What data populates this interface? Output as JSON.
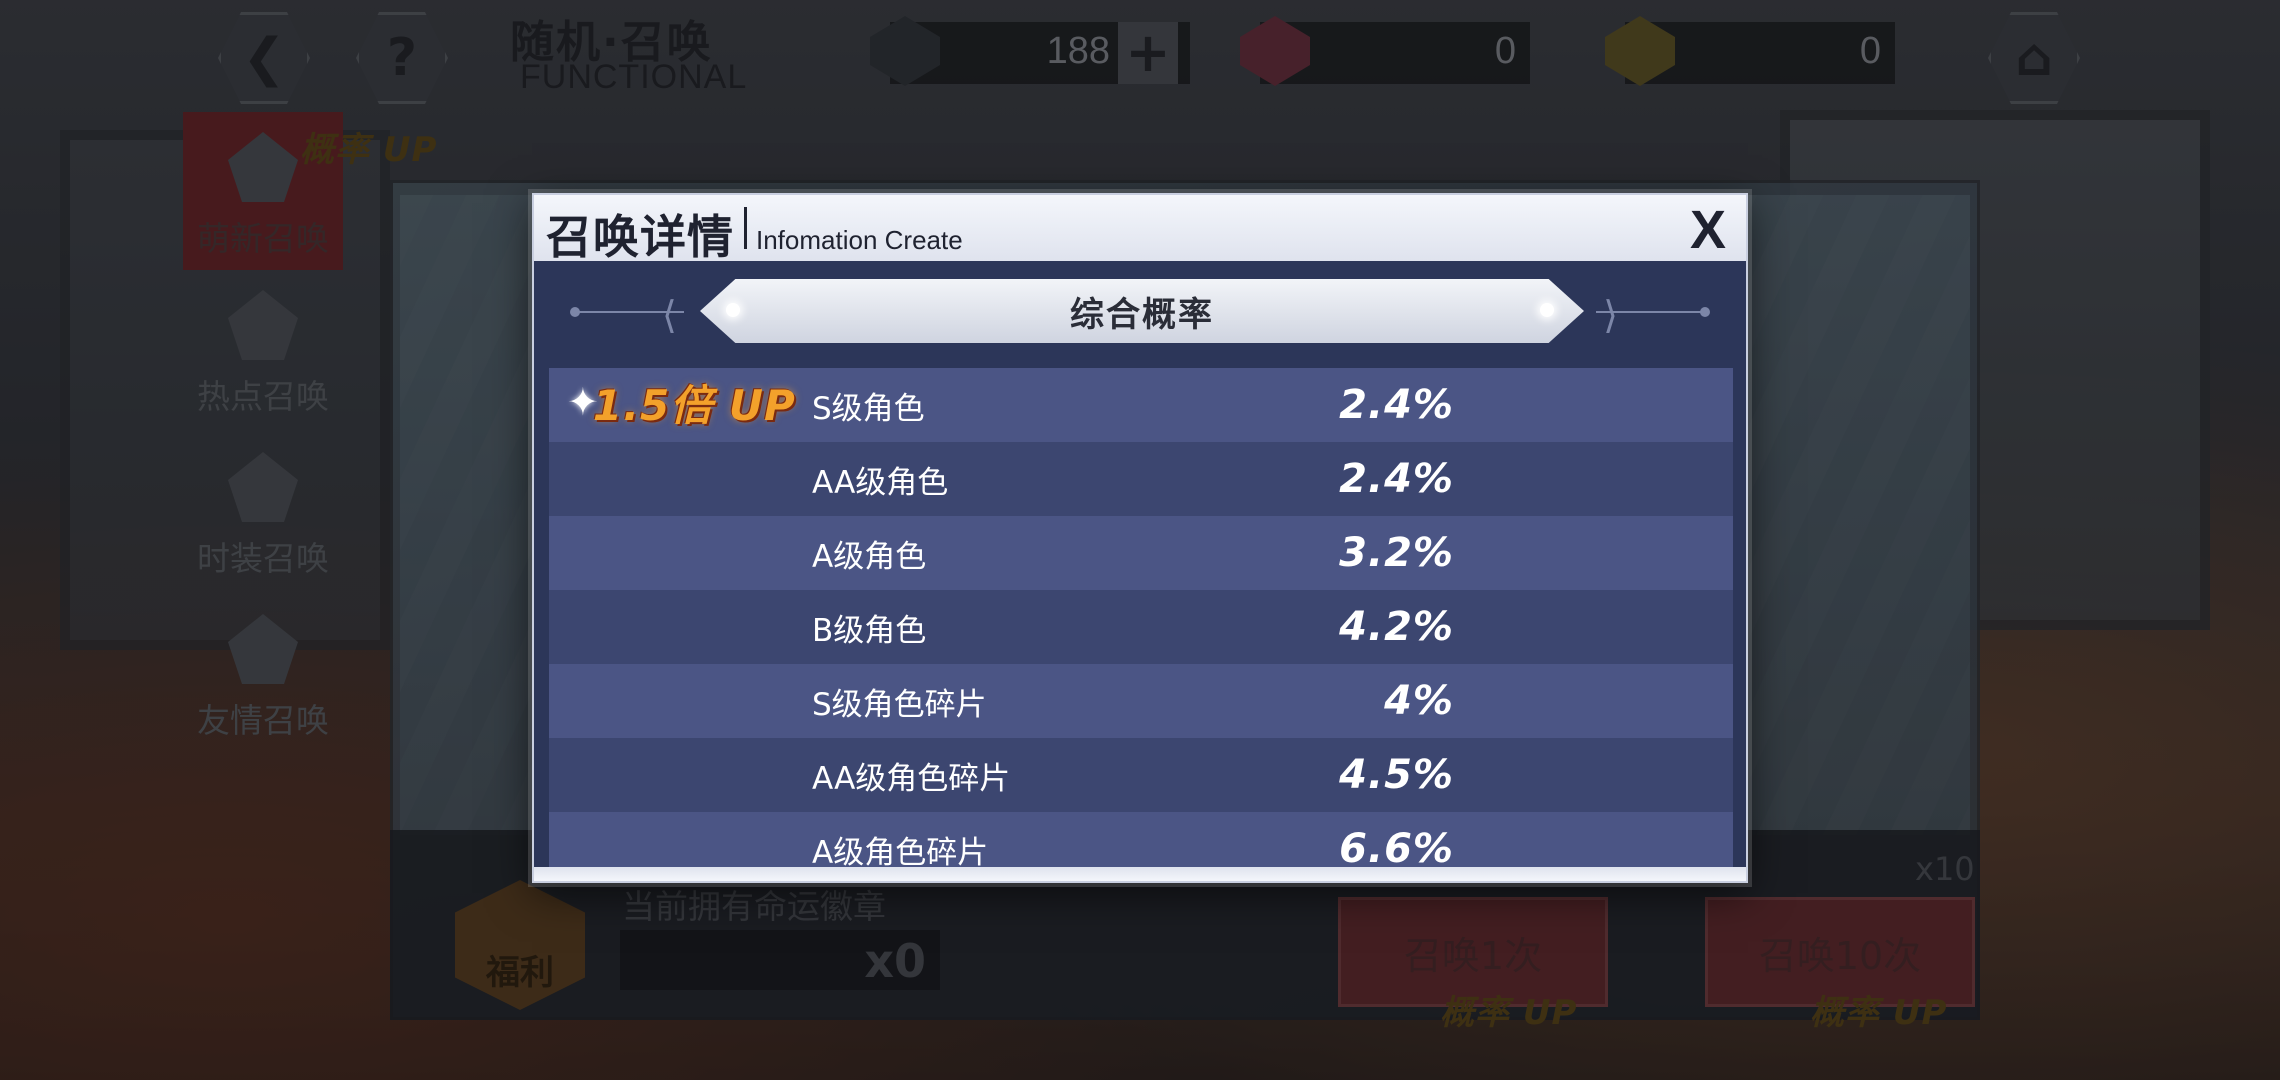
{
  "header": {
    "title": "随机·召唤",
    "subtitle": "FUNCTIONAL",
    "back_icon": "back-arrow-icon",
    "help_icon": "question-icon",
    "home_icon": "home-icon"
  },
  "currencies": [
    {
      "name": "crystal",
      "value": "188",
      "icon": "crystal-icon",
      "has_plus": true
    },
    {
      "name": "pink-badge",
      "value": "0",
      "icon": "pink-heart-badge-icon"
    },
    {
      "name": "gold-badge",
      "value": "0",
      "icon": "gold-heart-badge-icon"
    }
  ],
  "sidebar": {
    "items": [
      {
        "label": "萌新召唤",
        "tag": "概率 UP",
        "active": true
      },
      {
        "label": "热点召唤"
      },
      {
        "label": "时装召唤"
      },
      {
        "label": "友情召唤"
      }
    ]
  },
  "bottom": {
    "welfare_label": "福利",
    "owned_label": "当前拥有命运徽章",
    "owned_count": "x0",
    "summon_once": "召唤1次",
    "summon_ten": "召唤10次",
    "multiplier": "x10",
    "rate_up_tag": "概率 UP"
  },
  "modal": {
    "title": "召唤详情",
    "subtitle": "Infomation Create",
    "close_label": "X",
    "section_title": "综合概率",
    "boost_badge": "1.5倍 UP",
    "rows": [
      {
        "name": "S级角色",
        "pct": "2.4%"
      },
      {
        "name": "AA级角色",
        "pct": "2.4%"
      },
      {
        "name": "A级角色",
        "pct": "3.2%"
      },
      {
        "name": "B级角色",
        "pct": "4.2%"
      },
      {
        "name": "S级角色碎片",
        "pct": "4%"
      },
      {
        "name": "AA级角色碎片",
        "pct": "4.5%"
      },
      {
        "name": "A级角色碎片",
        "pct": "6.6%"
      }
    ]
  },
  "colors": {
    "modal_bg": "#2c3659",
    "row_light": "#4b5585",
    "row_dark": "#3c4670",
    "boost": "#f3a12b"
  }
}
